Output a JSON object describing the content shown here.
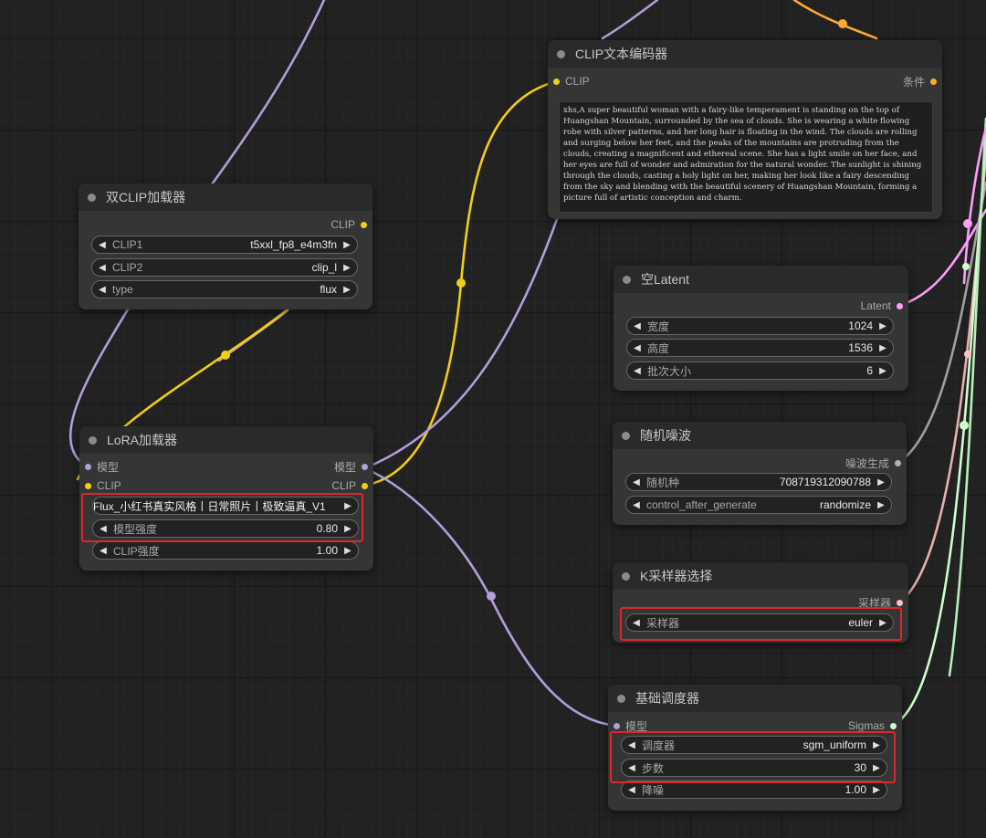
{
  "colors": {
    "clip": "#f2cd14",
    "model": "#b39ddb",
    "latent": "#ff9cf9",
    "conditioning": "#ffa931",
    "noise": "#b0b0b0",
    "sampler": "#ffc0c0",
    "sigmas": "#cdffcd",
    "highlight": "#e0262b"
  },
  "dual_clip": {
    "title": "双CLIP加载器",
    "out_clip": "CLIP",
    "widgets": [
      {
        "name": "CLIP1",
        "value": "t5xxl_fp8_e4m3fn"
      },
      {
        "name": "CLIP2",
        "value": "clip_l"
      },
      {
        "name": "type",
        "value": "flux"
      }
    ]
  },
  "lora": {
    "title": "LoRA加载器",
    "in_model": "模型",
    "in_clip": "CLIP",
    "out_model": "模型",
    "out_clip": "CLIP",
    "widgets": [
      {
        "name": "",
        "value": "Flux_小红书真实风格丨日常照片丨极致逼真_V1"
      },
      {
        "name": "模型强度",
        "value": "0.80"
      },
      {
        "name": "CLIP强度",
        "value": "1.00"
      }
    ]
  },
  "clip_text": {
    "title": "CLIP文本编码器",
    "in_clip": "CLIP",
    "out_cond": "条件",
    "text": "xhs,A super beautiful woman with a fairy-like temperament is standing on the top of Huangshan Mountain, surrounded by the sea of clouds. She is wearing a white flowing robe with silver patterns, and her long hair is floating in the wind. The clouds are rolling and surging below her feet, and the peaks of the mountains are protruding from the clouds, creating a magnificent and ethereal scene. She has a light smile on her face, and her eyes are full of wonder and admiration for the natural wonder. The sunlight is shining through the clouds, casting a holy light on her, making her look like a fairy descending from the sky and blending with the beautiful scenery of Huangshan Mountain, forming a picture full of artistic conception and charm."
  },
  "empty_latent": {
    "title": "空Latent",
    "out": "Latent",
    "widgets": [
      {
        "name": "宽度",
        "value": "1024"
      },
      {
        "name": "高度",
        "value": "1536"
      },
      {
        "name": "批次大小",
        "value": "6"
      }
    ]
  },
  "noise": {
    "title": "随机噪波",
    "out": "噪波生成",
    "widgets": [
      {
        "name": "随机种",
        "value": "708719312090788"
      },
      {
        "name": "control_after_generate",
        "value": "randomize"
      }
    ]
  },
  "ksampler": {
    "title": "K采样器选择",
    "out": "采样器",
    "widgets": [
      {
        "name": "采样器",
        "value": "euler"
      }
    ]
  },
  "scheduler": {
    "title": "基础调度器",
    "in_model": "模型",
    "out": "Sigmas",
    "widgets": [
      {
        "name": "调度器",
        "value": "sgm_uniform"
      },
      {
        "name": "步数",
        "value": "30"
      },
      {
        "name": "降噪",
        "value": "1.00"
      }
    ]
  }
}
